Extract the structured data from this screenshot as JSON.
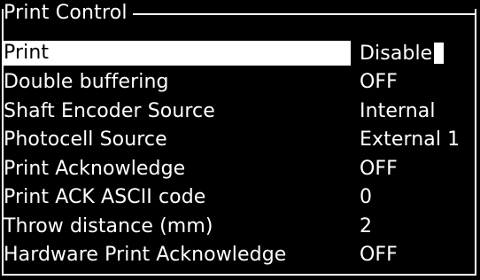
{
  "screen": {
    "title": "Print Control"
  },
  "rows": [
    {
      "label": "Print",
      "value": "Disable"
    },
    {
      "label": "Double buffering",
      "value": "OFF"
    },
    {
      "label": "Shaft Encoder Source",
      "value": "Internal"
    },
    {
      "label": "Photocell Source",
      "value": "External 1"
    },
    {
      "label": "Print Acknowledge",
      "value": "OFF"
    },
    {
      "label": "Print ACK ASCII code",
      "value": "0"
    },
    {
      "label": "Throw distance (mm)",
      "value": "2"
    },
    {
      "label": "Hardware Print Acknowledge",
      "value": "OFF"
    }
  ],
  "colors": {
    "background": "#000000",
    "foreground": "#ffffff"
  }
}
